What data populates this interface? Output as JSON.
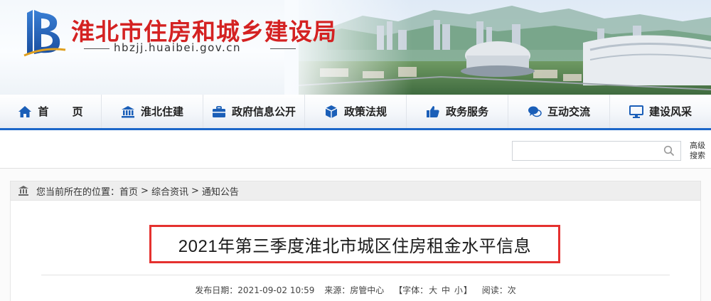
{
  "header": {
    "site_title": "淮北市住房和城乡建设局",
    "site_domain": "hbzjj.huaibei.gov.cn",
    "brand_color": "#d42222"
  },
  "nav": {
    "items": [
      {
        "label": "首  页",
        "icon": "home-icon"
      },
      {
        "label": "淮北住建",
        "icon": "bank-icon"
      },
      {
        "label": "政府信息公开",
        "icon": "briefcase-icon"
      },
      {
        "label": "政策法规",
        "icon": "cube-icon"
      },
      {
        "label": "政务服务",
        "icon": "thumbs-up-icon"
      },
      {
        "label": "互动交流",
        "icon": "chat-icon"
      },
      {
        "label": "建设风采",
        "icon": "monitor-icon"
      }
    ],
    "accent_color": "#1b66c9"
  },
  "search": {
    "placeholder": "",
    "advanced_label_line1": "高级",
    "advanced_label_line2": "搜索"
  },
  "breadcrumb": {
    "prefix": "您当前所在的位置：",
    "items": [
      "首页",
      "综合资讯",
      "通知公告"
    ],
    "separator": ">"
  },
  "article": {
    "title": "2021年第三季度淮北市城区住房租金水平信息",
    "highlight_color": "#e5312f",
    "meta": {
      "date_label": "发布日期：",
      "date_value": "2021-09-02 10:59",
      "source_label": "来源：",
      "source_value": "房管中心",
      "font_label": "【字体：",
      "font_large": "大",
      "font_medium": "中",
      "font_small": "小",
      "font_close": "】",
      "reads_label": "阅读：",
      "reads_suffix": "次"
    }
  }
}
